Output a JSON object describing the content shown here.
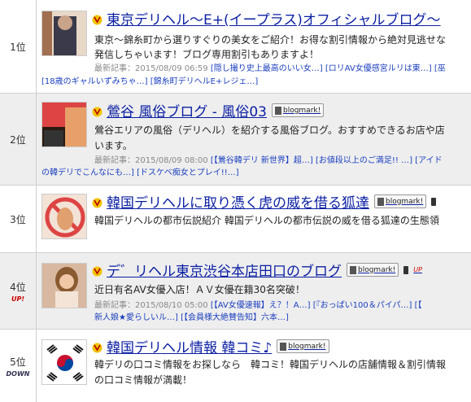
{
  "rows": [
    {
      "rank": "1位",
      "title": "東京デリヘル～E+(イープラス)オフィシャルブログ～",
      "desc1": "東京～錦糸町から選りすぐりの美女をご紹介！お得な割引情報から絶対見逃せな",
      "desc2": "発信しちゃいます！ブログ専用割引もありますよ！",
      "meta_label": "最新記事：2015/08/09 06:59",
      "meta_links": [
        "[隠し撮り史上最高のいい女…]",
        "[ロリAV女優感宮ルリは東…]",
        "[巫"
      ],
      "meta_line2": [
        "[18歳のギャルいずみちゃ…]",
        "[錦糸町デリヘルE+レジェ…]"
      ]
    },
    {
      "rank": "2位",
      "title": "鶯谷 風俗ブログ - 風俗03",
      "bookmark": "blogmark!",
      "desc1": "鶯谷エリアの風俗（デリヘル）を紹介する風俗ブログ。おすすめできるお店や店",
      "desc2": "います。",
      "meta_label": "最新記事：2015/08/09 08:00",
      "meta_links": [
        "[【鶯谷韓デリ 新世界】超…]",
        "[お値段以上のご満足!! …]",
        "[アイド"
      ],
      "meta_line2": [
        "の韓デリでこんなにも…]",
        "[ドスケベ痴女とプレイ!!…]"
      ]
    },
    {
      "rank": "3位",
      "title": "韓国デリヘルに取り憑く虎の威を借る狐達",
      "bookmark": "blogmark!",
      "desc1": "韓国デリヘルの都市伝説紹介 韓国デリヘルの都市伝説の威を借る狐達の生態領"
    },
    {
      "rank": "4位",
      "badge": "UP!",
      "title": "デ゛リヘル東京渋谷本店田口のブログ",
      "bookmark": "blogmark!",
      "up_label": "UP",
      "desc1": "近日有名AV女優入店！ＡＶ女優在籍30名突破！",
      "meta_label": "最新記事：2015/08/10 05:00",
      "meta_links": [
        "[【AV女優速報】え？！A…]",
        "[『おっぱい100＆パイパ…]",
        "[【"
      ],
      "meta_line2": [
        "新人娘★愛らしいル…]",
        "[【会員様大絶賛告知】六本…]"
      ]
    },
    {
      "rank": "5位",
      "badge": "DOWN",
      "title": "韓国デリヘル情報 韓コミ♪",
      "bookmark": "blogmark!",
      "desc1": "韓デリの口コミ情報をお探しなら　韓コミ！韓国デリヘルの店舗情報＆割引情報",
      "desc2": "の口コミ情報が満載！"
    }
  ]
}
